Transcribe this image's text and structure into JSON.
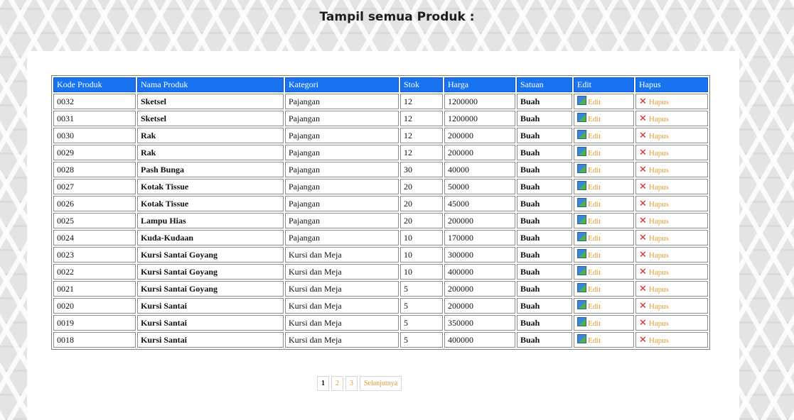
{
  "page": {
    "title": "Tampil semua Produk :"
  },
  "table": {
    "headers": [
      "Kode Produk",
      "Nama Produk",
      "Kategori",
      "Stok",
      "Harga",
      "Satuan",
      "Edit",
      "Hapus"
    ],
    "edit_label": "Edit",
    "hapus_label": "Hapus",
    "rows": [
      {
        "kode": "0032",
        "nama": "Sketsel",
        "kategori": "Pajangan",
        "stok": "12",
        "harga": "1200000",
        "satuan": "Buah"
      },
      {
        "kode": "0031",
        "nama": "Sketsel",
        "kategori": "Pajangan",
        "stok": "12",
        "harga": "1200000",
        "satuan": "Buah"
      },
      {
        "kode": "0030",
        "nama": "Rak",
        "kategori": "Pajangan",
        "stok": "12",
        "harga": "200000",
        "satuan": "Buah"
      },
      {
        "kode": "0029",
        "nama": "Rak",
        "kategori": "Pajangan",
        "stok": "12",
        "harga": "200000",
        "satuan": "Buah"
      },
      {
        "kode": "0028",
        "nama": "Pash Bunga",
        "kategori": "Pajangan",
        "stok": "30",
        "harga": "40000",
        "satuan": "Buah"
      },
      {
        "kode": "0027",
        "nama": "Kotak Tissue",
        "kategori": "Pajangan",
        "stok": "20",
        "harga": "50000",
        "satuan": "Buah"
      },
      {
        "kode": "0026",
        "nama": "Kotak Tissue",
        "kategori": "Pajangan",
        "stok": "20",
        "harga": "45000",
        "satuan": "Buah"
      },
      {
        "kode": "0025",
        "nama": "Lampu Hias",
        "kategori": "Pajangan",
        "stok": "20",
        "harga": "200000",
        "satuan": "Buah"
      },
      {
        "kode": "0024",
        "nama": "Kuda-Kudaan",
        "kategori": "Pajangan",
        "stok": "10",
        "harga": "170000",
        "satuan": "Buah"
      },
      {
        "kode": "0023",
        "nama": "Kursi Santai Goyang",
        "kategori": "Kursi dan Meja",
        "stok": "10",
        "harga": "300000",
        "satuan": "Buah"
      },
      {
        "kode": "0022",
        "nama": "Kursi Santai Goyang",
        "kategori": "Kursi dan Meja",
        "stok": "10",
        "harga": "400000",
        "satuan": "Buah"
      },
      {
        "kode": "0021",
        "nama": "Kursi Santai Goyang",
        "kategori": "Kursi dan Meja",
        "stok": "5",
        "harga": "200000",
        "satuan": "Buah"
      },
      {
        "kode": "0020",
        "nama": "Kursi Santai",
        "kategori": "Kursi dan Meja",
        "stok": "5",
        "harga": "200000",
        "satuan": "Buah"
      },
      {
        "kode": "0019",
        "nama": "Kursi Santai",
        "kategori": "Kursi dan Meja",
        "stok": "5",
        "harga": "350000",
        "satuan": "Buah"
      },
      {
        "kode": "0018",
        "nama": "Kursi Santai",
        "kategori": "Kursi dan Meja",
        "stok": "5",
        "harga": "400000",
        "satuan": "Buah"
      }
    ]
  },
  "pagination": {
    "pages": [
      "1",
      "2",
      "3"
    ],
    "current": "1",
    "next_label": "Selanjutnya"
  },
  "icons": {
    "edit": "edit-icon",
    "hapus": "delete-x-icon"
  },
  "colors": {
    "header_bg": "#1873f0",
    "link": "#e79a2e",
    "delete_icon": "#d8231b"
  }
}
